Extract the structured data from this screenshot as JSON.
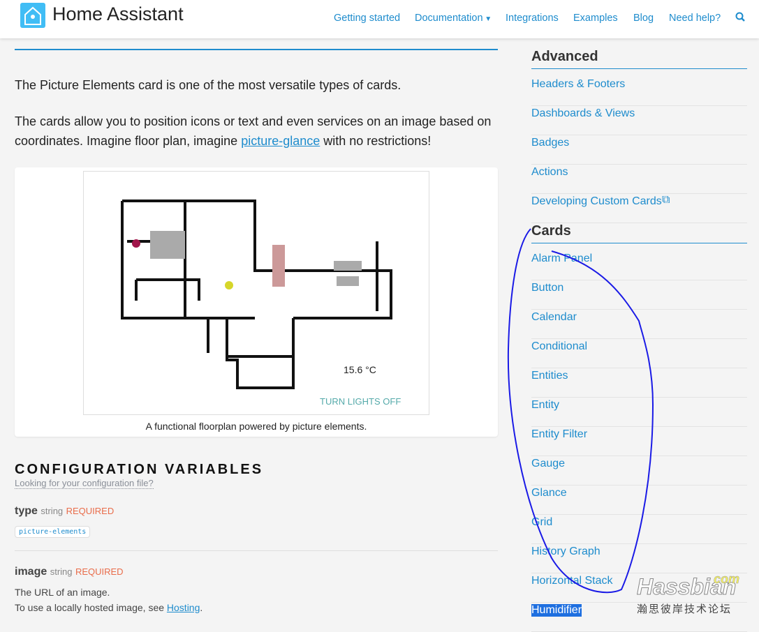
{
  "header": {
    "brand": "Home Assistant",
    "nav": [
      "Getting started",
      "Documentation",
      "Integrations",
      "Examples",
      "Blog",
      "Need help?"
    ],
    "dropdown_icon": "caret-down",
    "search_icon": "search"
  },
  "main": {
    "intro": "The Picture Elements card is one of the most versatile types of cards.",
    "para_before": "The cards allow you to position icons or text and even services on an image based on coordinates. Imagine floor plan, imagine ",
    "para_link": "picture-glance",
    "para_after": " with no restrictions!",
    "floorplan": {
      "temperature": "15.6 °C",
      "button": "TURN LIGHTS OFF",
      "caption": "A functional floorplan powered by picture elements."
    },
    "config_title": "CONFIGURATION VARIABLES",
    "config_link": "Looking for your configuration file?",
    "vars": [
      {
        "name": "type",
        "type": "string",
        "required": "REQUIRED",
        "code": "picture-elements"
      },
      {
        "name": "image",
        "type": "string",
        "required": "REQUIRED",
        "desc1": "The URL of an image.",
        "desc2_before": "To use a locally hosted image, see ",
        "desc2_link": "Hosting",
        "desc2_after": "."
      }
    ]
  },
  "sidebar": {
    "advanced_title": "Advanced",
    "advanced": [
      "Headers & Footers",
      "Dashboards & Views",
      "Badges",
      "Actions",
      "Developing Custom Cards"
    ],
    "cards_title": "Cards",
    "cards": [
      "Alarm Panel",
      "Button",
      "Calendar",
      "Conditional",
      "Entities",
      "Entity",
      "Entity Filter",
      "Gauge",
      "Glance",
      "Grid",
      "History Graph",
      "Horizontal Stack",
      "Humidifier"
    ],
    "selected": "Humidifier"
  },
  "watermark": {
    "text": "Hassbian",
    "com": "com",
    "cn": "瀚思彼岸技术论坛"
  },
  "colors": {
    "accent": "#1e8ccd",
    "required": "#e96c4a",
    "annotation": "#1a1ae6"
  }
}
